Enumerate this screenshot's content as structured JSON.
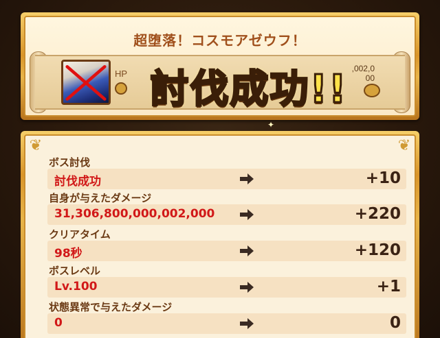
{
  "banner": {
    "title": "超堕落！コスモアゼウフ！",
    "hp_label": "HP",
    "hp_value": ",002,0\n00",
    "victory_text": "討伐成功!!",
    "boss_status": "defeated"
  },
  "results": {
    "rows": [
      {
        "label": "ボス討伐",
        "value": "討伐成功",
        "points": "+10"
      },
      {
        "label": "自身が与えたダメージ",
        "value": "31,306,800,000,002,000",
        "points": "+220"
      },
      {
        "label": "クリアタイム",
        "value": "98秒",
        "points": "+120"
      },
      {
        "label": "ボスレベル",
        "value": "Lv.100",
        "points": "+1"
      },
      {
        "label": "状態異常で与えたダメージ",
        "value": "0",
        "points": "0"
      }
    ]
  },
  "colors": {
    "frame_gold": "#d9952a",
    "value_red": "#d11818",
    "label_brown": "#6b3a14",
    "victory_yellow": "#ffe24a"
  },
  "icons": [
    "cross-mark-icon",
    "right-arrow-icon",
    "corner-ornament-icon",
    "sparkle-icon"
  ]
}
